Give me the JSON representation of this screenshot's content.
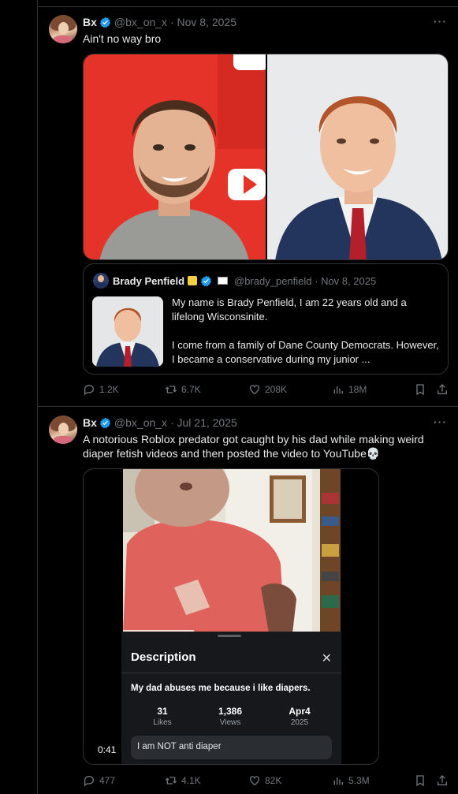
{
  "tweets": [
    {
      "name": "Bx",
      "handle_date": "@bx_on_x · Nov 8, 2025",
      "text": "Ain't no way bro",
      "quote": {
        "name": "Brady Penfield",
        "handle_date": "@brady_penfield · Nov 8, 2025",
        "text_1": "My name is Brady Penfield, I am 22 years old and a lifelong Wisconsinite.",
        "text_2": "I come from a family of Dane County Democrats. However, I became a conservative during my junior ..."
      },
      "actions": {
        "replies": "1.2K",
        "reposts": "6.7K",
        "likes": "208K",
        "views": "18M"
      }
    },
    {
      "name": "Bx",
      "handle_date": "@bx_on_x · Jul 21, 2025",
      "text": "A notorious Roblox predator got caught by his dad while making weird diaper fetish videos and then posted the video to YouTube💀",
      "video": {
        "desc_title": "Description",
        "desc_line": "My dad abuses me because i like diapers.",
        "stats": [
          {
            "value": "31",
            "label": "Likes"
          },
          {
            "value": "1,386",
            "label": "Views"
          },
          {
            "value": "Apr4",
            "label": "2025"
          }
        ],
        "comment": "I am NOT anti diaper",
        "timestamp": "0:41"
      },
      "actions": {
        "replies": "477",
        "reposts": "4.1K",
        "likes": "82K",
        "views": "5.3M"
      }
    }
  ],
  "colors": {
    "background": "#000000",
    "verified": "#1d9bf0",
    "muted": "#71767b",
    "border": "#2f3336"
  },
  "icons": [
    "verified-badge-icon",
    "more-icon",
    "reply-icon",
    "repost-icon",
    "like-icon",
    "views-icon",
    "bookmark-icon",
    "share-icon",
    "close-icon",
    "skull-emoji"
  ]
}
